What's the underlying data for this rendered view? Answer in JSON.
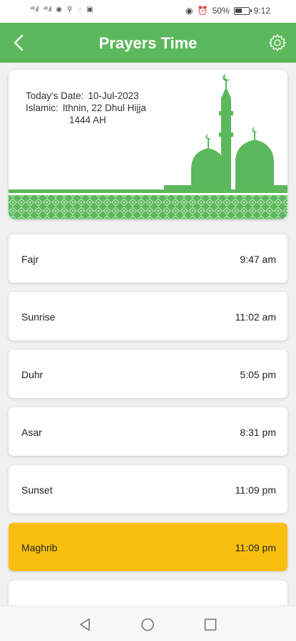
{
  "status_bar": {
    "left_signal_1": "⁴⁶.ıl",
    "left_signal_2": "⁴⁶.ıl",
    "right_battery": "50%",
    "right_time": "9:12"
  },
  "app_bar": {
    "title": "Prayers Time",
    "back_icon": "chevron-left-icon",
    "settings_icon": "gear-icon"
  },
  "date_card": {
    "today_label": "Today's Date:",
    "today_value": "10-Jul-2023",
    "islamic_label": "Islamic:",
    "islamic_value_line1": "Ithnin, 22 Dhul Hijja",
    "islamic_value_line2": "1444 AH"
  },
  "prayers": [
    {
      "name": "Fajr",
      "time": "9:47 am",
      "active": false
    },
    {
      "name": "Sunrise",
      "time": "11:02 am",
      "active": false
    },
    {
      "name": "Duhr",
      "time": "5:05 pm",
      "active": false
    },
    {
      "name": "Asar",
      "time": "8:31 pm",
      "active": false
    },
    {
      "name": "Sunset",
      "time": "11:09 pm",
      "active": false
    },
    {
      "name": "Maghrib",
      "time": "11:09 pm",
      "active": true
    }
  ],
  "colors": {
    "primary_green": "#5cb85c",
    "highlight_yellow": "#f9bf10"
  },
  "nav_bar": {
    "back_icon": "triangle-back-icon",
    "home_icon": "circle-home-icon",
    "recents_icon": "square-recents-icon"
  }
}
